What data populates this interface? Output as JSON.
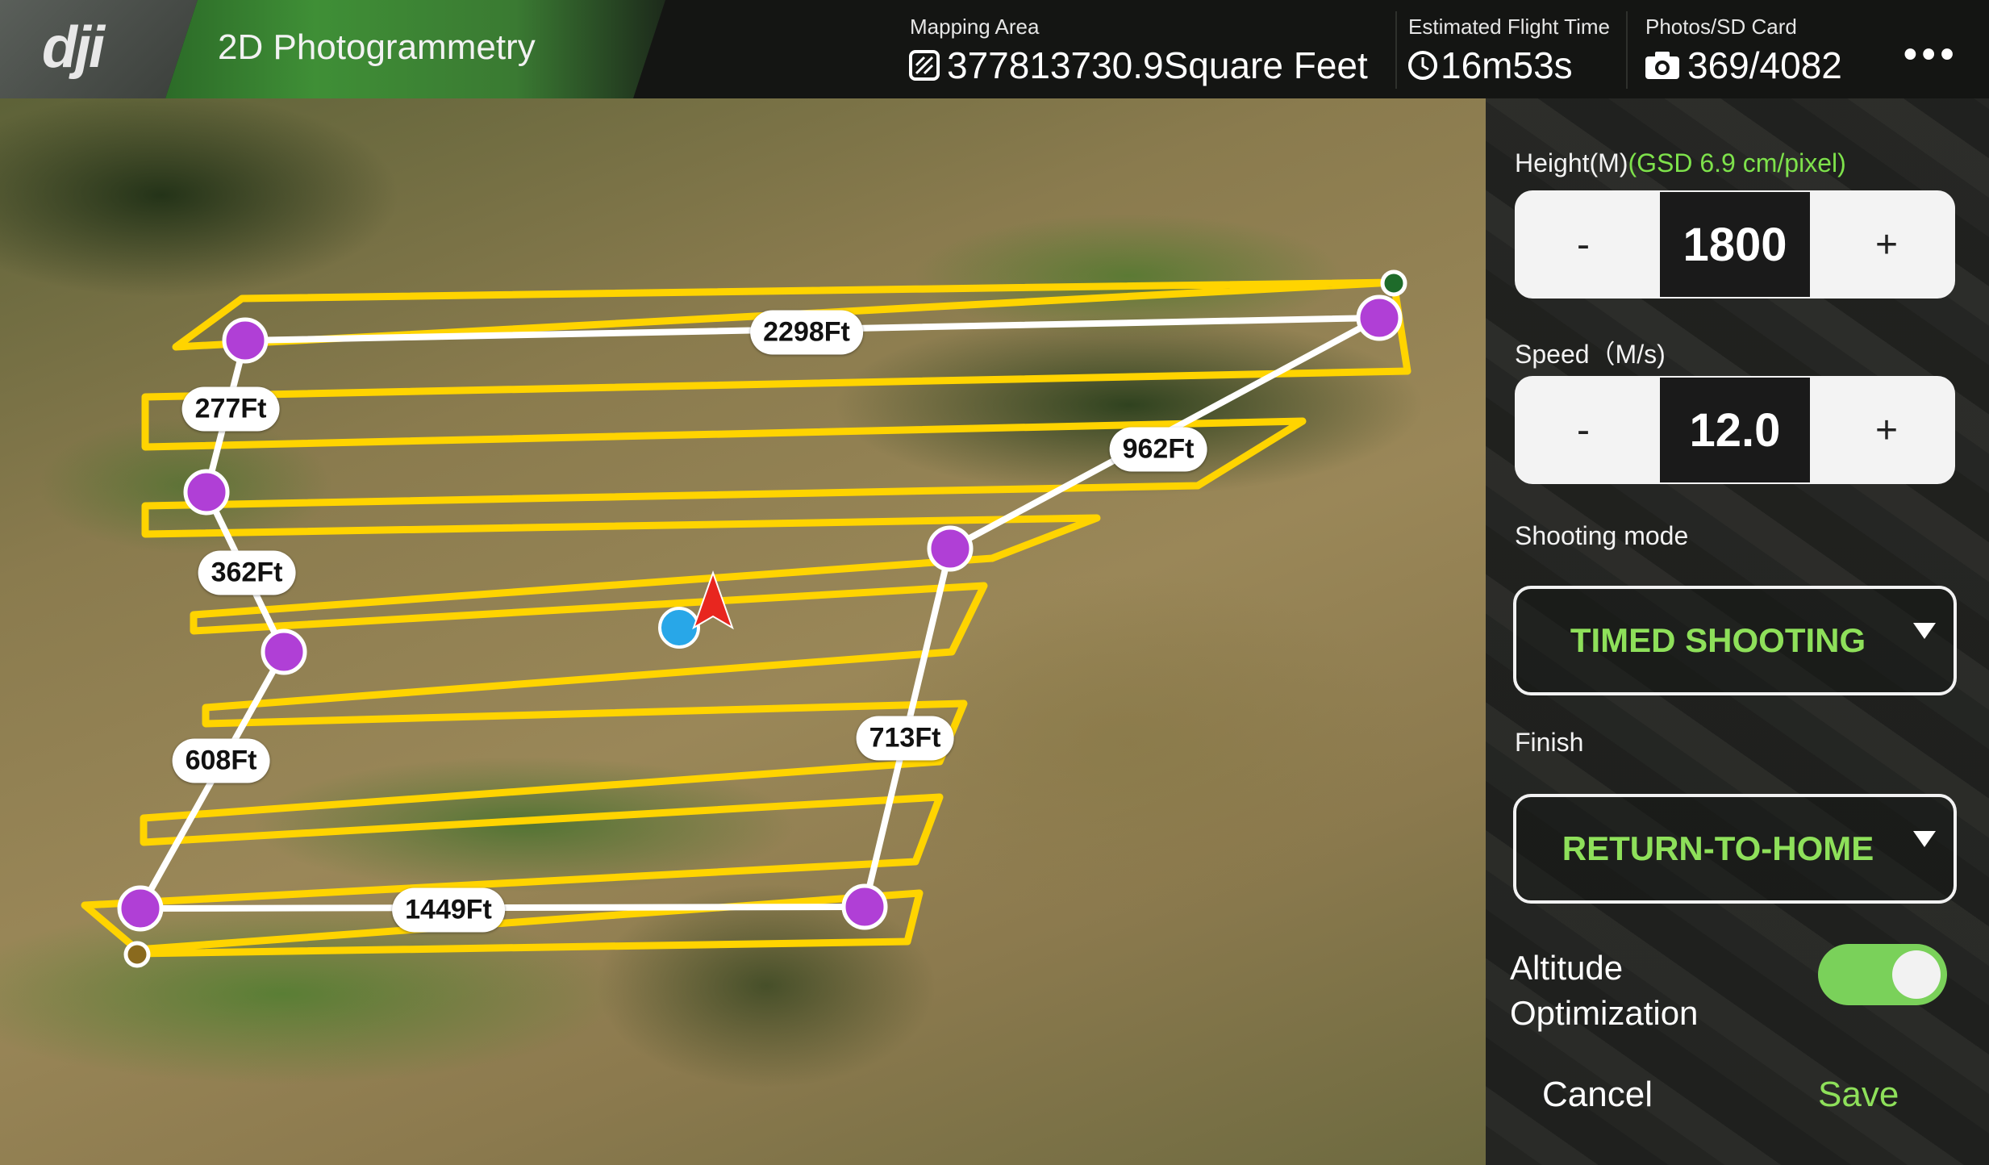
{
  "header": {
    "logo_text": "dji",
    "mode_title": "2D Photogrammetry",
    "mapping_area": {
      "label": "Mapping Area",
      "value": "377813730.9Square Feet"
    },
    "flight_time": {
      "label": "Estimated Flight Time",
      "value": "16m53s"
    },
    "photos": {
      "label": "Photos/SD Card",
      "value": "369/4082"
    },
    "more_label": "•••"
  },
  "map": {
    "distance_labels": [
      "2298Ft",
      "277Ft",
      "962Ft",
      "362Ft",
      "608Ft",
      "713Ft",
      "1449Ft"
    ],
    "route_color": "#ffd400",
    "boundary_color": "#ffffff",
    "waypoint_color": "#b03fd6",
    "home_point_color": "#28a7e8",
    "aircraft_color": "#e8261f"
  },
  "panel": {
    "height": {
      "label": "Height(M)",
      "gsd": "(GSD   6.9 cm/pixel)",
      "value": "1800",
      "minus": "-",
      "plus": "+"
    },
    "speed": {
      "label": "Speed（M/s)",
      "value": "12.0",
      "minus": "-",
      "plus": "+"
    },
    "shooting_mode": {
      "label": "Shooting mode",
      "value": "TIMED SHOOTING"
    },
    "finish": {
      "label": "Finish",
      "value": "RETURN-TO-HOME"
    },
    "altitude_optimization": {
      "label": "Altitude Optimization",
      "enabled": true
    },
    "cancel_label": "Cancel",
    "save_label": "Save"
  }
}
